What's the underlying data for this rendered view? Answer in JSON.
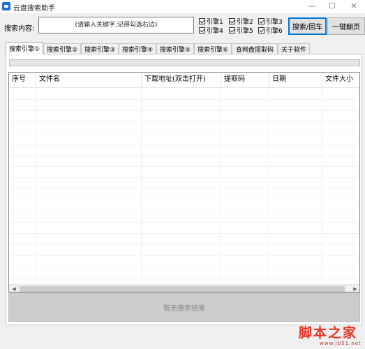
{
  "window": {
    "title": "云盘搜索助手",
    "controls": {
      "minimize": "—",
      "maximize": "☐",
      "close": "✕"
    }
  },
  "search": {
    "label": "搜索内容:",
    "placeholder": "(请输入关键字,记得勾选右边)",
    "value": ""
  },
  "engines": [
    {
      "label": "引擎1",
      "checked": true
    },
    {
      "label": "引擎2",
      "checked": true
    },
    {
      "label": "引擎3",
      "checked": true
    },
    {
      "label": "引擎4",
      "checked": true
    },
    {
      "label": "引擎5",
      "checked": true
    },
    {
      "label": "引擎6",
      "checked": true
    }
  ],
  "buttons": {
    "search": "搜索/回车",
    "page": "一键翻页"
  },
  "tabs": [
    {
      "label": "搜索引擎①",
      "active": true
    },
    {
      "label": "搜索引擎②",
      "active": false
    },
    {
      "label": "搜索引擎③",
      "active": false
    },
    {
      "label": "搜索引擎④",
      "active": false
    },
    {
      "label": "搜索引擎⑤",
      "active": false
    },
    {
      "label": "搜索引擎⑥",
      "active": false
    },
    {
      "label": "查网盘提取码",
      "active": false
    },
    {
      "label": "关于软件",
      "active": false
    }
  ],
  "progress": {
    "value": 0
  },
  "table": {
    "columns": [
      "序号",
      "文件名",
      "下载地址(双击打开)",
      "提取码",
      "日期",
      "文件大小"
    ],
    "rows": []
  },
  "status": {
    "text": "暂无搜索结果"
  },
  "scrollbar": {
    "left": "◀",
    "right": "▶"
  },
  "watermark": {
    "logo": "脚本之家",
    "url": "www.jb51.net"
  },
  "colors": {
    "accent": "#0078d7",
    "progress": "#06b025",
    "watermark": "#e63322"
  }
}
